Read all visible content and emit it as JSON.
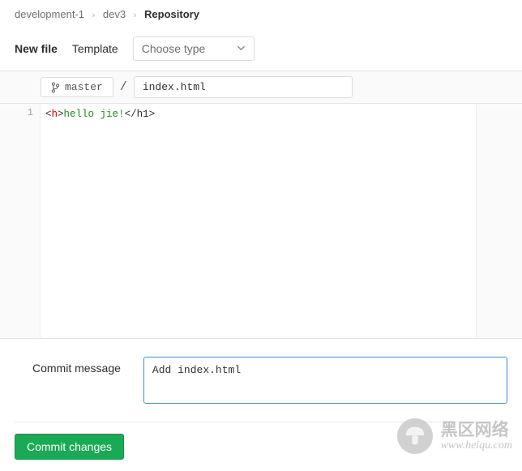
{
  "breadcrumb": {
    "item1": "development-1",
    "item2": "dev3",
    "current": "Repository"
  },
  "toolbar": {
    "new_file_label": "New file",
    "template_label": "Template",
    "template_value": "Choose type"
  },
  "file_header": {
    "branch": "master",
    "path_sep": "/",
    "filename": "index.html"
  },
  "editor": {
    "line_numbers": [
      "1"
    ],
    "line1_p1": "<",
    "line1_p2": "h",
    "line1_p3": ">",
    "line1_text": "hello jie!",
    "line1_p4": "</",
    "line1_p5": "h1",
    "line1_p6": ">"
  },
  "commit": {
    "label": "Commit message",
    "message": "Add index.html"
  },
  "actions": {
    "commit_button": "Commit changes"
  },
  "watermark": {
    "line1": "黑区网络",
    "line2": "www.heiqu.com"
  }
}
